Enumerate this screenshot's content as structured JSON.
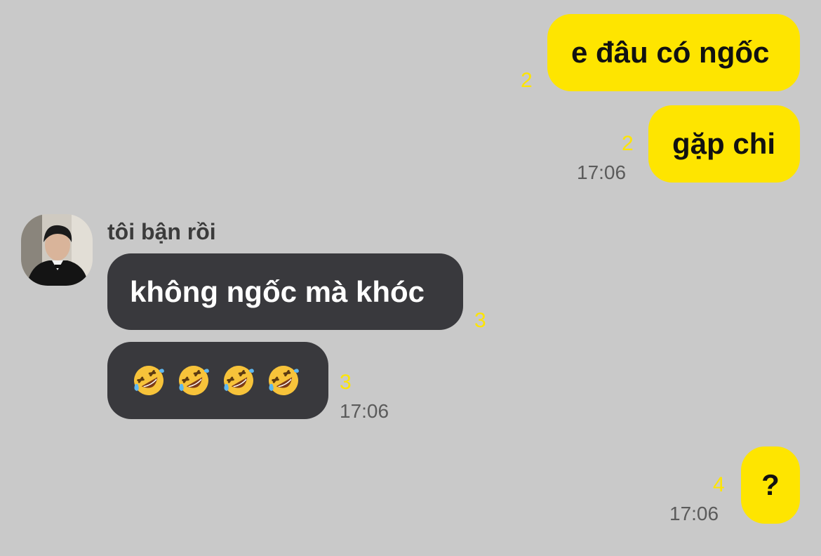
{
  "messages": {
    "m1": {
      "text": "e đâu có ngốc",
      "unread": "2"
    },
    "m2": {
      "text": "gặp chi",
      "unread": "2",
      "time": "17:06"
    },
    "m3": {
      "sender": "tôi bận rồi",
      "text": "không ngốc mà khóc",
      "unread": "3"
    },
    "m4": {
      "emojis": [
        "rolling-on-floor-laughing",
        "rolling-on-floor-laughing",
        "rolling-on-floor-laughing",
        "rolling-on-floor-laughing"
      ],
      "unread": "3",
      "time": "17:06"
    },
    "m5": {
      "text": "?",
      "unread": "4",
      "time": "17:06"
    }
  },
  "colors": {
    "background": "#c9c9c9",
    "outgoing_bubble": "#fee500",
    "incoming_bubble": "#39393d",
    "unread_count": "#fee500"
  }
}
